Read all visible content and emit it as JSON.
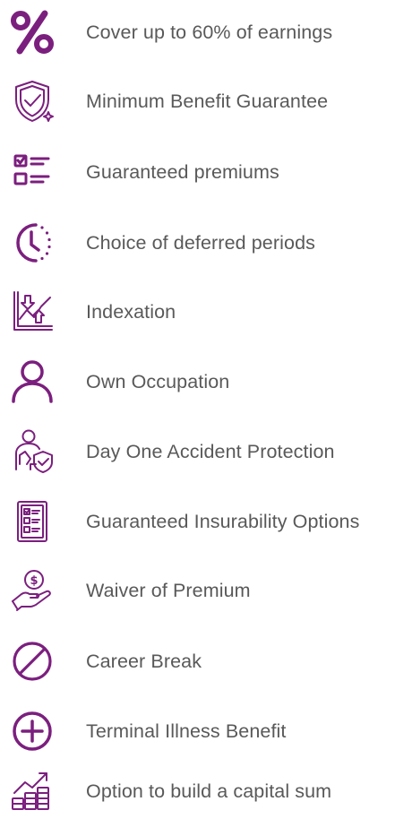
{
  "theme": {
    "icon_color": "#7b1f7e",
    "text_color": "#595959",
    "background": "#ffffff"
  },
  "features": [
    {
      "label": "Cover up to 60% of earnings",
      "icon": "percent-icon"
    },
    {
      "label": "Minimum Benefit Guarantee",
      "icon": "shield-check-icon"
    },
    {
      "label": "Guaranteed premiums",
      "icon": "checklist-icon"
    },
    {
      "label": "Choice of deferred periods",
      "icon": "clock-icon"
    },
    {
      "label": "Indexation",
      "icon": "index-chart-icon"
    },
    {
      "label": "Own Occupation",
      "icon": "person-icon"
    },
    {
      "label": "Day One Accident Protection",
      "icon": "accident-protection-icon"
    },
    {
      "label": "Guaranteed Insurability Options",
      "icon": "checklist-document-icon"
    },
    {
      "label": "Waiver of Premium",
      "icon": "hand-coin-icon"
    },
    {
      "label": "Career Break",
      "icon": "prohibited-icon"
    },
    {
      "label": "Terminal Illness Benefit",
      "icon": "plus-circle-icon"
    },
    {
      "label": "Option to build a capital sum",
      "icon": "growth-coins-icon"
    }
  ]
}
